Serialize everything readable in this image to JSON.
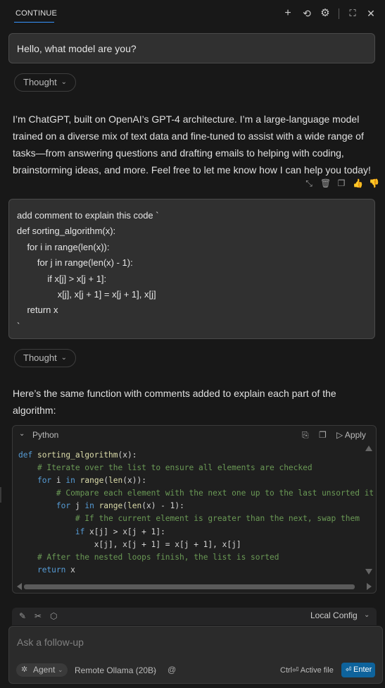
{
  "header": {
    "title": "CONTINUE",
    "icons": [
      "plus-icon",
      "history-icon",
      "gear-icon",
      "fullscreen-icon",
      "close-icon"
    ]
  },
  "messages": [
    {
      "role": "user",
      "text": "Hello, what model are you?"
    },
    {
      "role": "assistant_thought",
      "label": "Thought"
    },
    {
      "role": "assistant",
      "text": "I’m ChatGPT, built on OpenAI’s GPT-4 architecture. I’m a large-language model trained on a diverse mix of text data and fine-tuned to assist with a wide range of tasks—from answering questions and drafting emails to helping with coding, brainstorming ideas, and more. Feel free to let me know how I can help you today!"
    },
    {
      "role": "user",
      "lines": [
        "add comment to explain this code `",
        "def sorting_algorithm(x):",
        "    for i in range(len(x)):",
        "        for j in range(len(x) - 1):",
        "            if x[j] > x[j + 1]:",
        "                x[j], x[j + 1] = x[j + 1], x[j]",
        "    return x",
        "`"
      ]
    },
    {
      "role": "assistant_thought",
      "label": "Thought"
    },
    {
      "role": "assistant",
      "text": "Here’s the same function with comments added to explain each part of the algorithm:"
    }
  ],
  "message_actions": [
    "compress-icon",
    "trash-icon",
    "copy-icon",
    "thumbs-up-icon",
    "thumbs-down-icon"
  ],
  "code_block": {
    "language": "Python",
    "apply_label": "Apply",
    "lines": [
      "def sorting_algorithm(x):",
      "    # Iterate over the list to ensure all elements are checked",
      "    for i in range(len(x)):",
      "        # Compare each element with the next one up to the last unsorted it",
      "        for j in range(len(x) - 1):",
      "            # If the current element is greater than the next, swap them",
      "            if x[j] > x[j + 1]:",
      "                x[j], x[j + 1] = x[j + 1], x[j]",
      "    # After the nested loops finish, the list is sorted",
      "    return x"
    ]
  },
  "toolbar": {
    "config_label": "Local Config"
  },
  "input": {
    "placeholder": "Ask a follow-up",
    "mode_label": "Agent",
    "model_label": "Remote Ollama (20B)",
    "active_file_label": "Ctrl⏎ Active file",
    "enter_label": "Enter"
  },
  "colors": {
    "background": "#181818",
    "accent": "#0e639c",
    "keyword": "#569cd6",
    "comment": "#6a9955",
    "function": "#dcdcaa"
  }
}
